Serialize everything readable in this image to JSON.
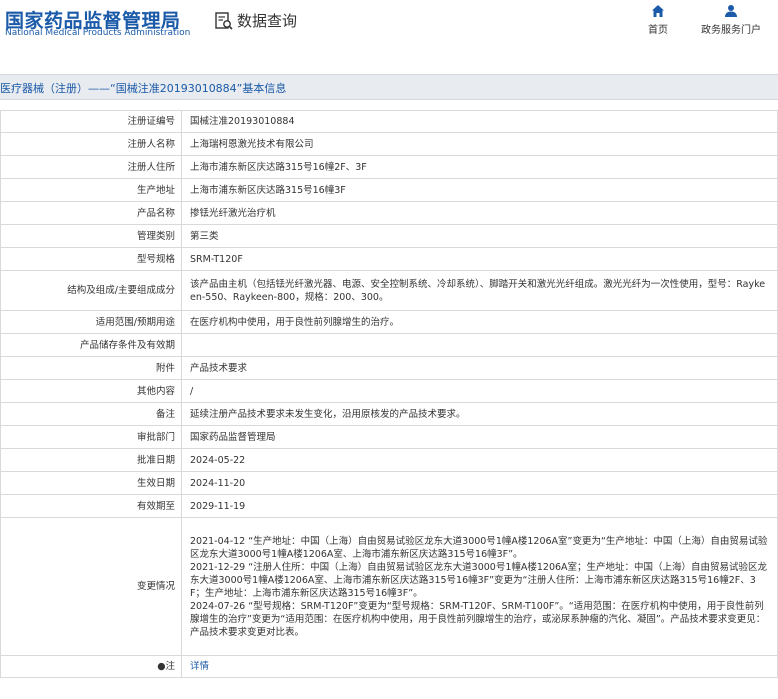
{
  "header": {
    "logo_cn": "国家药品监督管理局",
    "logo_en": "National Medical Products Administration",
    "query_label": "数据查询",
    "nav_home": "首页",
    "nav_service": "政务服务门户"
  },
  "title": "医疗器械（注册）——“国械注准20193010884”基本信息",
  "rows": [
    {
      "key": "注册证编号",
      "value": "国械注准20193010884"
    },
    {
      "key": "注册人名称",
      "value": "上海瑞柯恩激光技术有限公司"
    },
    {
      "key": "注册人住所",
      "value": "上海市浦东新区庆达路315号16幢2F、3F"
    },
    {
      "key": "生产地址",
      "value": "上海市浦东新区庆达路315号16幢3F"
    },
    {
      "key": "产品名称",
      "value": "掺铥光纤激光治疗机"
    },
    {
      "key": "管理类别",
      "value": "第三类"
    },
    {
      "key": "型号规格",
      "value": "SRM-T120F"
    },
    {
      "key": "结构及组成/主要组成成分",
      "value": "该产品由主机（包括铥光纤激光器、电源、安全控制系统、冷却系统）、脚踏开关和激光光纤组成。激光光纤为一次性使用，型号：Raykeen-550、Raykeen-800，规格：200、300。"
    },
    {
      "key": "适用范围/预期用途",
      "value": "在医疗机构中使用，用于良性前列腺增生的治疗。"
    },
    {
      "key": "产品储存条件及有效期",
      "value": ""
    },
    {
      "key": "附件",
      "value": "产品技术要求"
    },
    {
      "key": "其他内容",
      "value": "/"
    },
    {
      "key": "备注",
      "value": "延续注册产品技术要求未发生变化，沿用原核发的产品技术要求。"
    },
    {
      "key": "审批部门",
      "value": "国家药品监督管理局"
    },
    {
      "key": "批准日期",
      "value": "2024-05-22"
    },
    {
      "key": "生效日期",
      "value": "2024-11-20"
    },
    {
      "key": "有效期至",
      "value": "2029-11-19"
    }
  ],
  "change": {
    "key": "变更情况",
    "lines": [
      "2021-04-12 “生产地址：中国（上海）自由贸易试验区龙东大道3000号1幢A楼1206A室”变更为“生产地址：中国（上海）自由贸易试验区龙东大道3000号1幢A楼1206A室、上海市浦东新区庆达路315号16幢3F”。",
      "2021-12-29 “注册人住所：中国（上海）自由贸易试验区龙东大道3000号1幢A楼1206A室；生产地址：中国（上海）自由贸易试验区龙东大道3000号1幢A楼1206A室、上海市浦东新区庆达路315号16幢3F”变更为“注册人住所：上海市浦东新区庆达路315号16幢2F、3F；生产地址：上海市浦东新区庆达路315号16幢3F”。",
      "2024-07-26 “型号规格：SRM-T120F”变更为“型号规格：SRM-T120F、SRM-T100F”。“适用范围：在医疗机构中使用，用于良性前列腺增生的治疗”变更为“适用范围：在医疗机构中使用，用于良性前列腺增生的治疗，或泌尿系肿瘤的汽化、凝固”。产品技术要求变更见：产品技术要求变更对比表。"
    ]
  },
  "note": {
    "key": "●注",
    "value": "详情"
  }
}
